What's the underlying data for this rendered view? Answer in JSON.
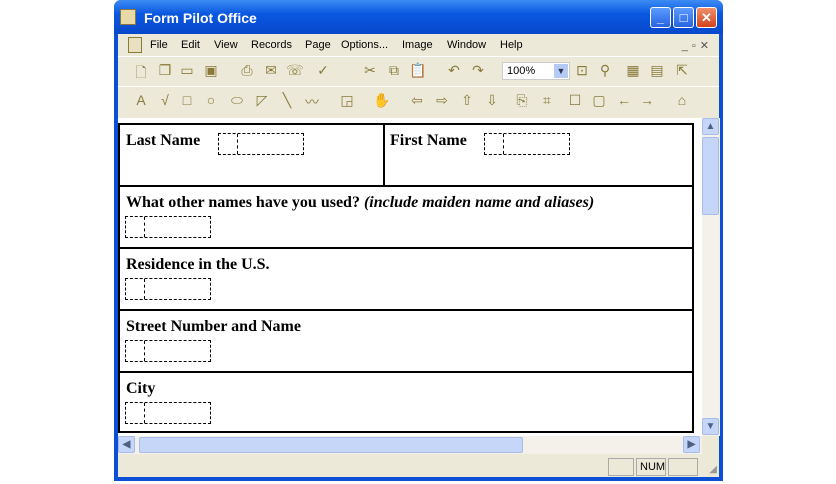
{
  "window": {
    "title": "Form Pilot Office"
  },
  "menu": [
    "File",
    "Edit",
    "View",
    "Records",
    "Page",
    "Options...",
    "Image",
    "Window",
    "Help"
  ],
  "toolbar1": [
    "new-icon",
    "copy-pages-icon",
    "open-icon",
    "save-icon",
    "print-icon",
    "mail-icon",
    "fax-icon",
    "spellcheck-icon",
    "cut-icon",
    "copy-icon",
    "paste-icon",
    "undo-icon",
    "redo-icon",
    "fit-page-icon",
    "magnifier-icon",
    "grid-icon",
    "form-icon",
    "export-icon"
  ],
  "zoom": "100%",
  "toolbar2": [
    "text-tool-icon",
    "check-tool-icon",
    "rectangle-tool-icon",
    "circle-tool-icon",
    "ellipse-tool-icon",
    "polygon-tool-icon",
    "line-tool-icon",
    "freehand-tool-icon",
    "field-icon",
    "hand-icon",
    "arrow-left-icon",
    "arrow-right-icon",
    "arrow-up-icon",
    "arrow-down-icon",
    "stamp-icon",
    "crop-icon",
    "white-box-icon",
    "grey-box-icon",
    "narrow-icon",
    "widen-icon",
    "home-icon"
  ],
  "form": {
    "last_name": "Last Name",
    "first_name": "First Name",
    "other_names": "What other names have you used?",
    "other_names_note": "(include maiden name and aliases)",
    "residence": "Residence in the U.S.",
    "street": "Street Number and Name",
    "city": "City"
  },
  "status": {
    "num": "NUM"
  }
}
